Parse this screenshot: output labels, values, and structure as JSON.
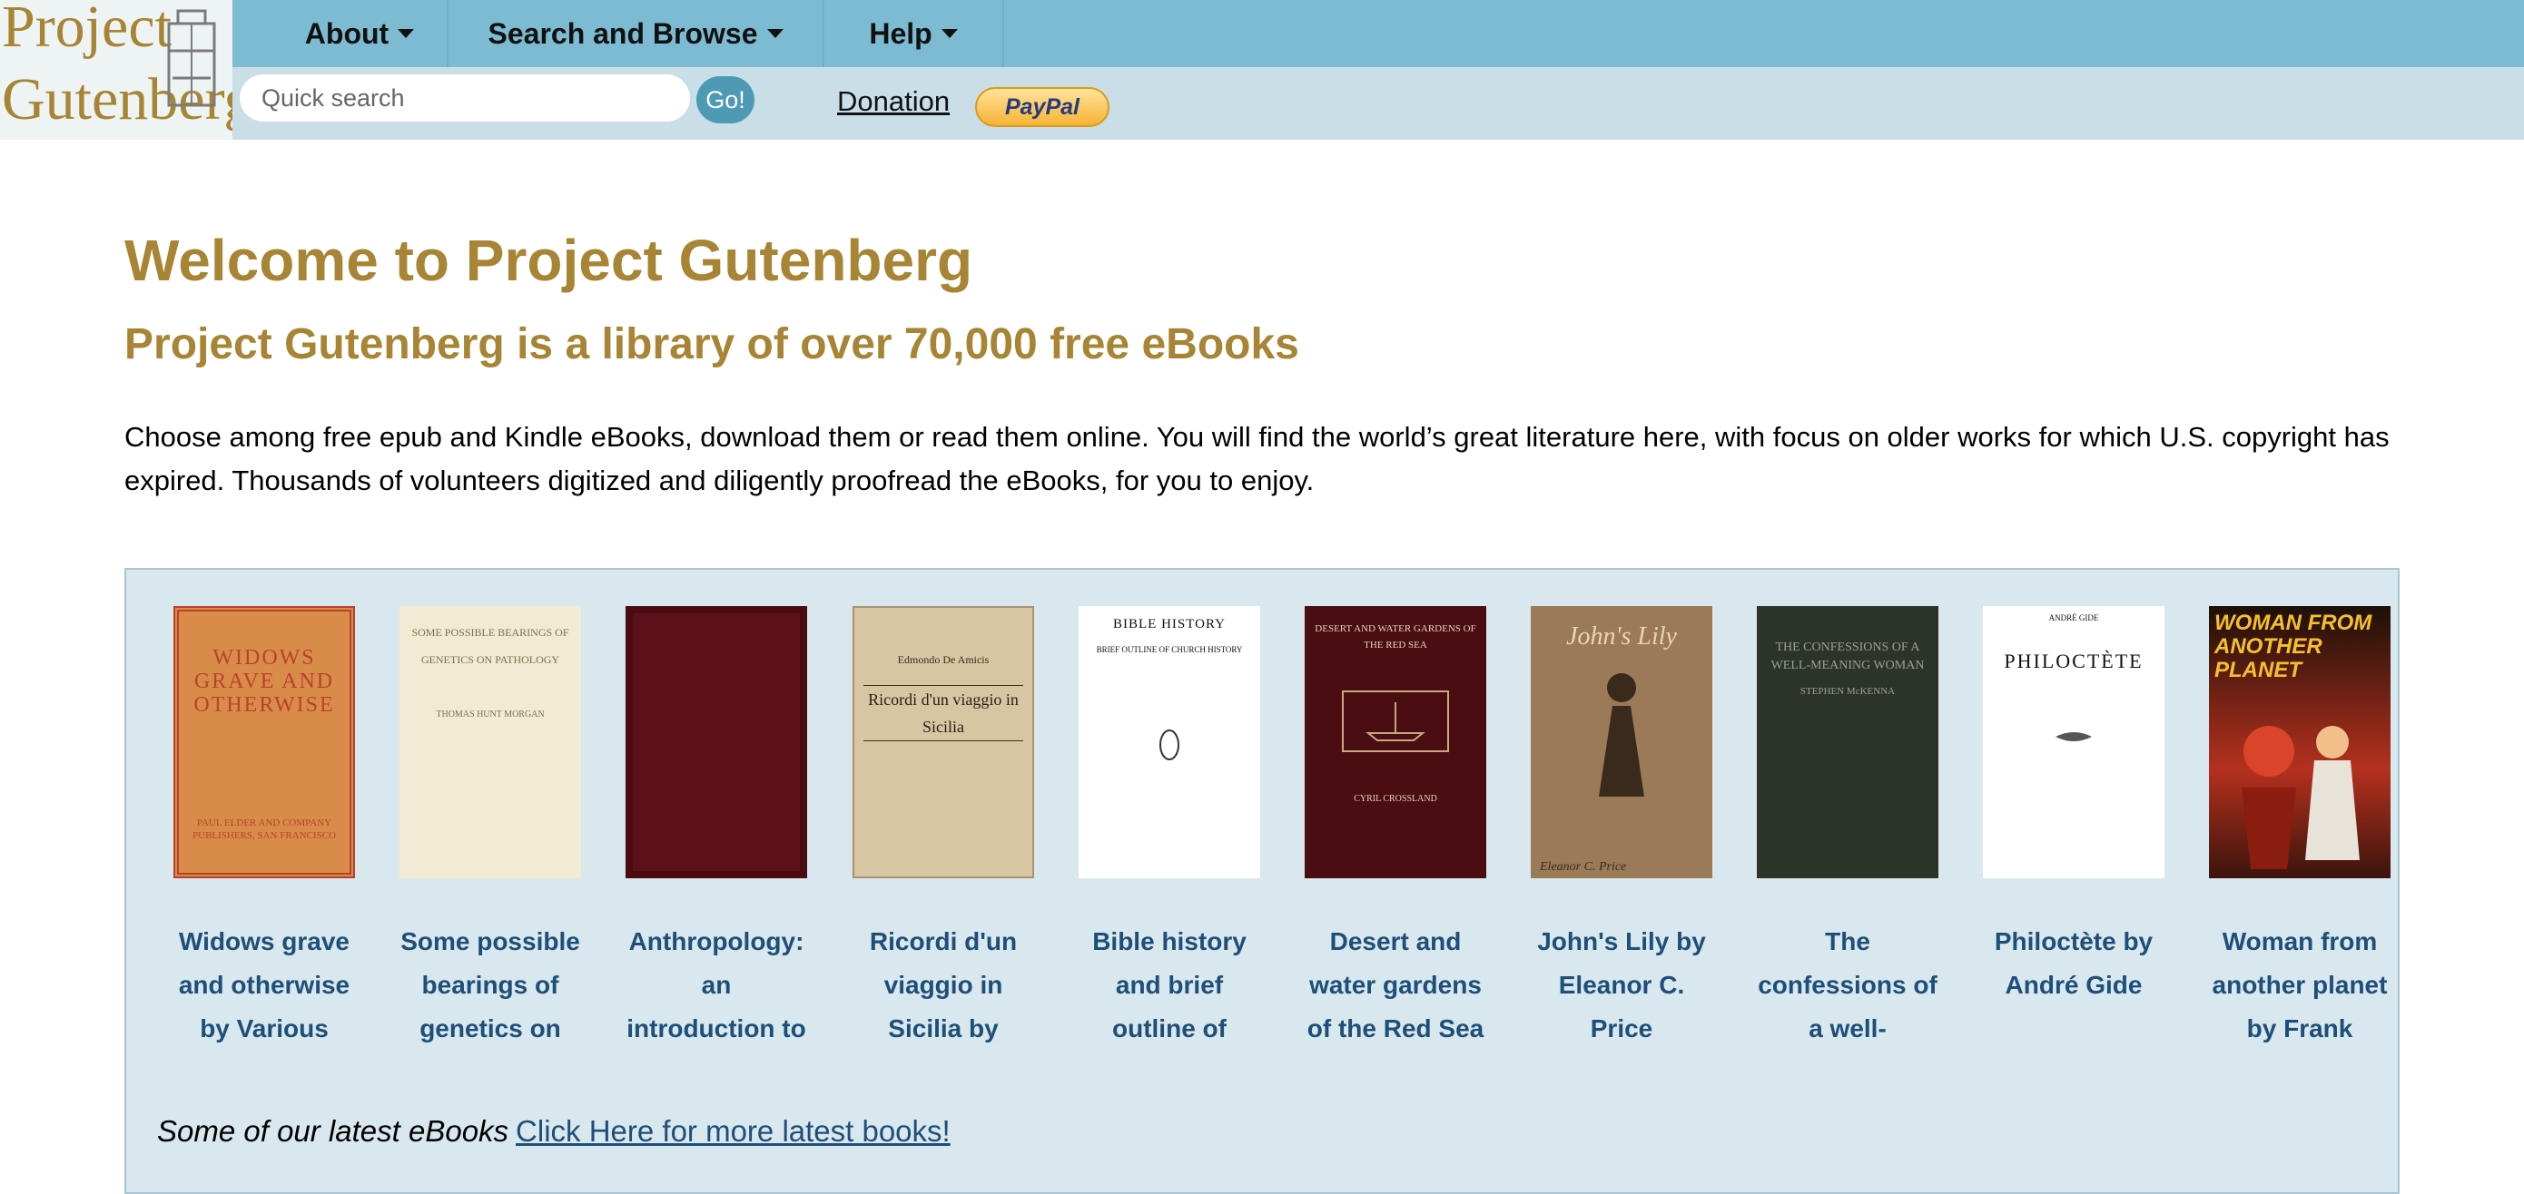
{
  "logo": {
    "line1": "Project",
    "line2": "Gutenberg"
  },
  "nav": {
    "about": "About",
    "search_browse": "Search and Browse",
    "help": "Help"
  },
  "search": {
    "placeholder": "Quick search",
    "go_label": "Go!"
  },
  "donation": {
    "label": "Donation",
    "paypal": "PayPal"
  },
  "main": {
    "title": "Welcome to Project Gutenberg",
    "subtitle": "Project Gutenberg is a library of over 70,000 free eBooks",
    "intro": "Choose among free epub and Kindle eBooks, download them or read them online. You will find the world’s great literature here, with focus on older works for which U.S. copyright has expired. Thousands of volunteers digitized and diligently proofread the eBooks, for you to enjoy."
  },
  "books": [
    {
      "title": "Widows grave and otherwise by Various",
      "cover_text": "WIDOWS GRAVE AND OTHERWISE",
      "cover_sub": "PAUL ELDER AND COMPANY PUBLISHERS, SAN FRANCISCO",
      "cover_color": "#d98b4a"
    },
    {
      "title": "Some possible bearings of genetics on pathology",
      "cover_text": "SOME POSSIBLE BEARINGS OF GENETICS ON PATHOLOGY",
      "cover_sub": "THOMAS HUNT MORGAN",
      "cover_color": "#f1ebd3"
    },
    {
      "title": "Anthropology: an introduction to",
      "cover_text": "",
      "cover_sub": "",
      "cover_color": "#5c1118"
    },
    {
      "title": "Ricordi d'un viaggio in Sicilia by",
      "cover_text": "Ricordi d'un viaggio in Sicilia",
      "cover_sub": "Edmondo De Amicis",
      "cover_color": "#d8c6a3"
    },
    {
      "title": "Bible history and brief outline of",
      "cover_text": "BIBLE HISTORY",
      "cover_sub": "BRIEF OUTLINE OF CHURCH HISTORY",
      "cover_color": "#ffffff"
    },
    {
      "title": "Desert and water gardens of the Red Sea",
      "cover_text": "DESERT AND WATER GARDENS OF THE RED SEA",
      "cover_sub": "CYRIL CROSSLAND",
      "cover_color": "#4a0d12"
    },
    {
      "title": "John's Lily by Eleanor C. Price",
      "cover_text": "John's Lily",
      "cover_sub": "Eleanor C. Price",
      "cover_color": "#9b7a58"
    },
    {
      "title": "The confessions of a well-meaning",
      "cover_text": "THE CONFESSIONS OF A WELL-MEANING WOMAN",
      "cover_sub": "STEPHEN McKENNA",
      "cover_color": "#2c3329"
    },
    {
      "title": "Philoctète by André Gide",
      "cover_text": "PHILOCTÈTE",
      "cover_sub": "ANDRÉ GIDE",
      "cover_color": "#ffffff"
    },
    {
      "title": "Woman from another planet by Frank",
      "cover_text": "WOMAN FROM ANOTHER PLANET",
      "cover_sub": "",
      "cover_color": "#b5301e"
    }
  ],
  "latest": {
    "text": "Some of our latest eBooks",
    "link": "Click Here for more latest books!"
  }
}
